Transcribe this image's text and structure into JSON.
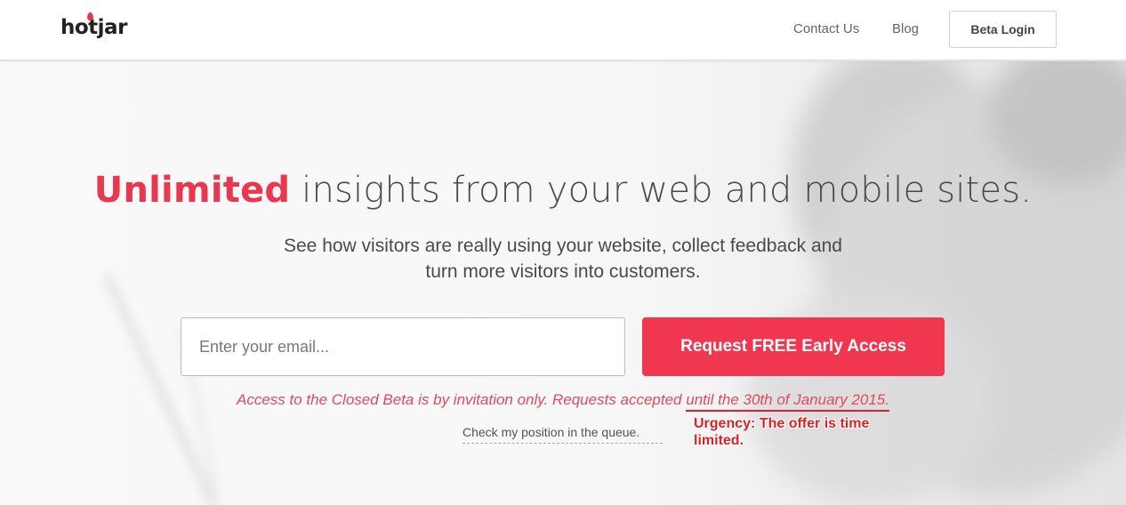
{
  "header": {
    "logo_text": "hotjar",
    "nav": {
      "contact": "Contact Us",
      "blog": "Blog",
      "beta_login": "Beta Login"
    }
  },
  "hero": {
    "headline_highlight": "Unlimited",
    "headline_rest": " insights from your web and mobile sites.",
    "subtitle_line1": "See how visitors are really using your website, collect feedback and",
    "subtitle_line2": "turn more visitors into customers.",
    "email_placeholder": "Enter your email...",
    "cta_label": "Request FREE Early Access",
    "notice_prefix": "Access to the Closed Beta is by invitation only. Requests accepted ",
    "notice_deadline": "until the 30th of January 2015.",
    "queue_link": "Check my position in the queue.",
    "annotation": "Urgency: The offer is time limited."
  },
  "colors": {
    "brand_red": "#f0374f",
    "highlight_red": "#e8374f",
    "annotation_red": "#e02020"
  },
  "icons": {
    "logo_mark": "flame-icon"
  }
}
